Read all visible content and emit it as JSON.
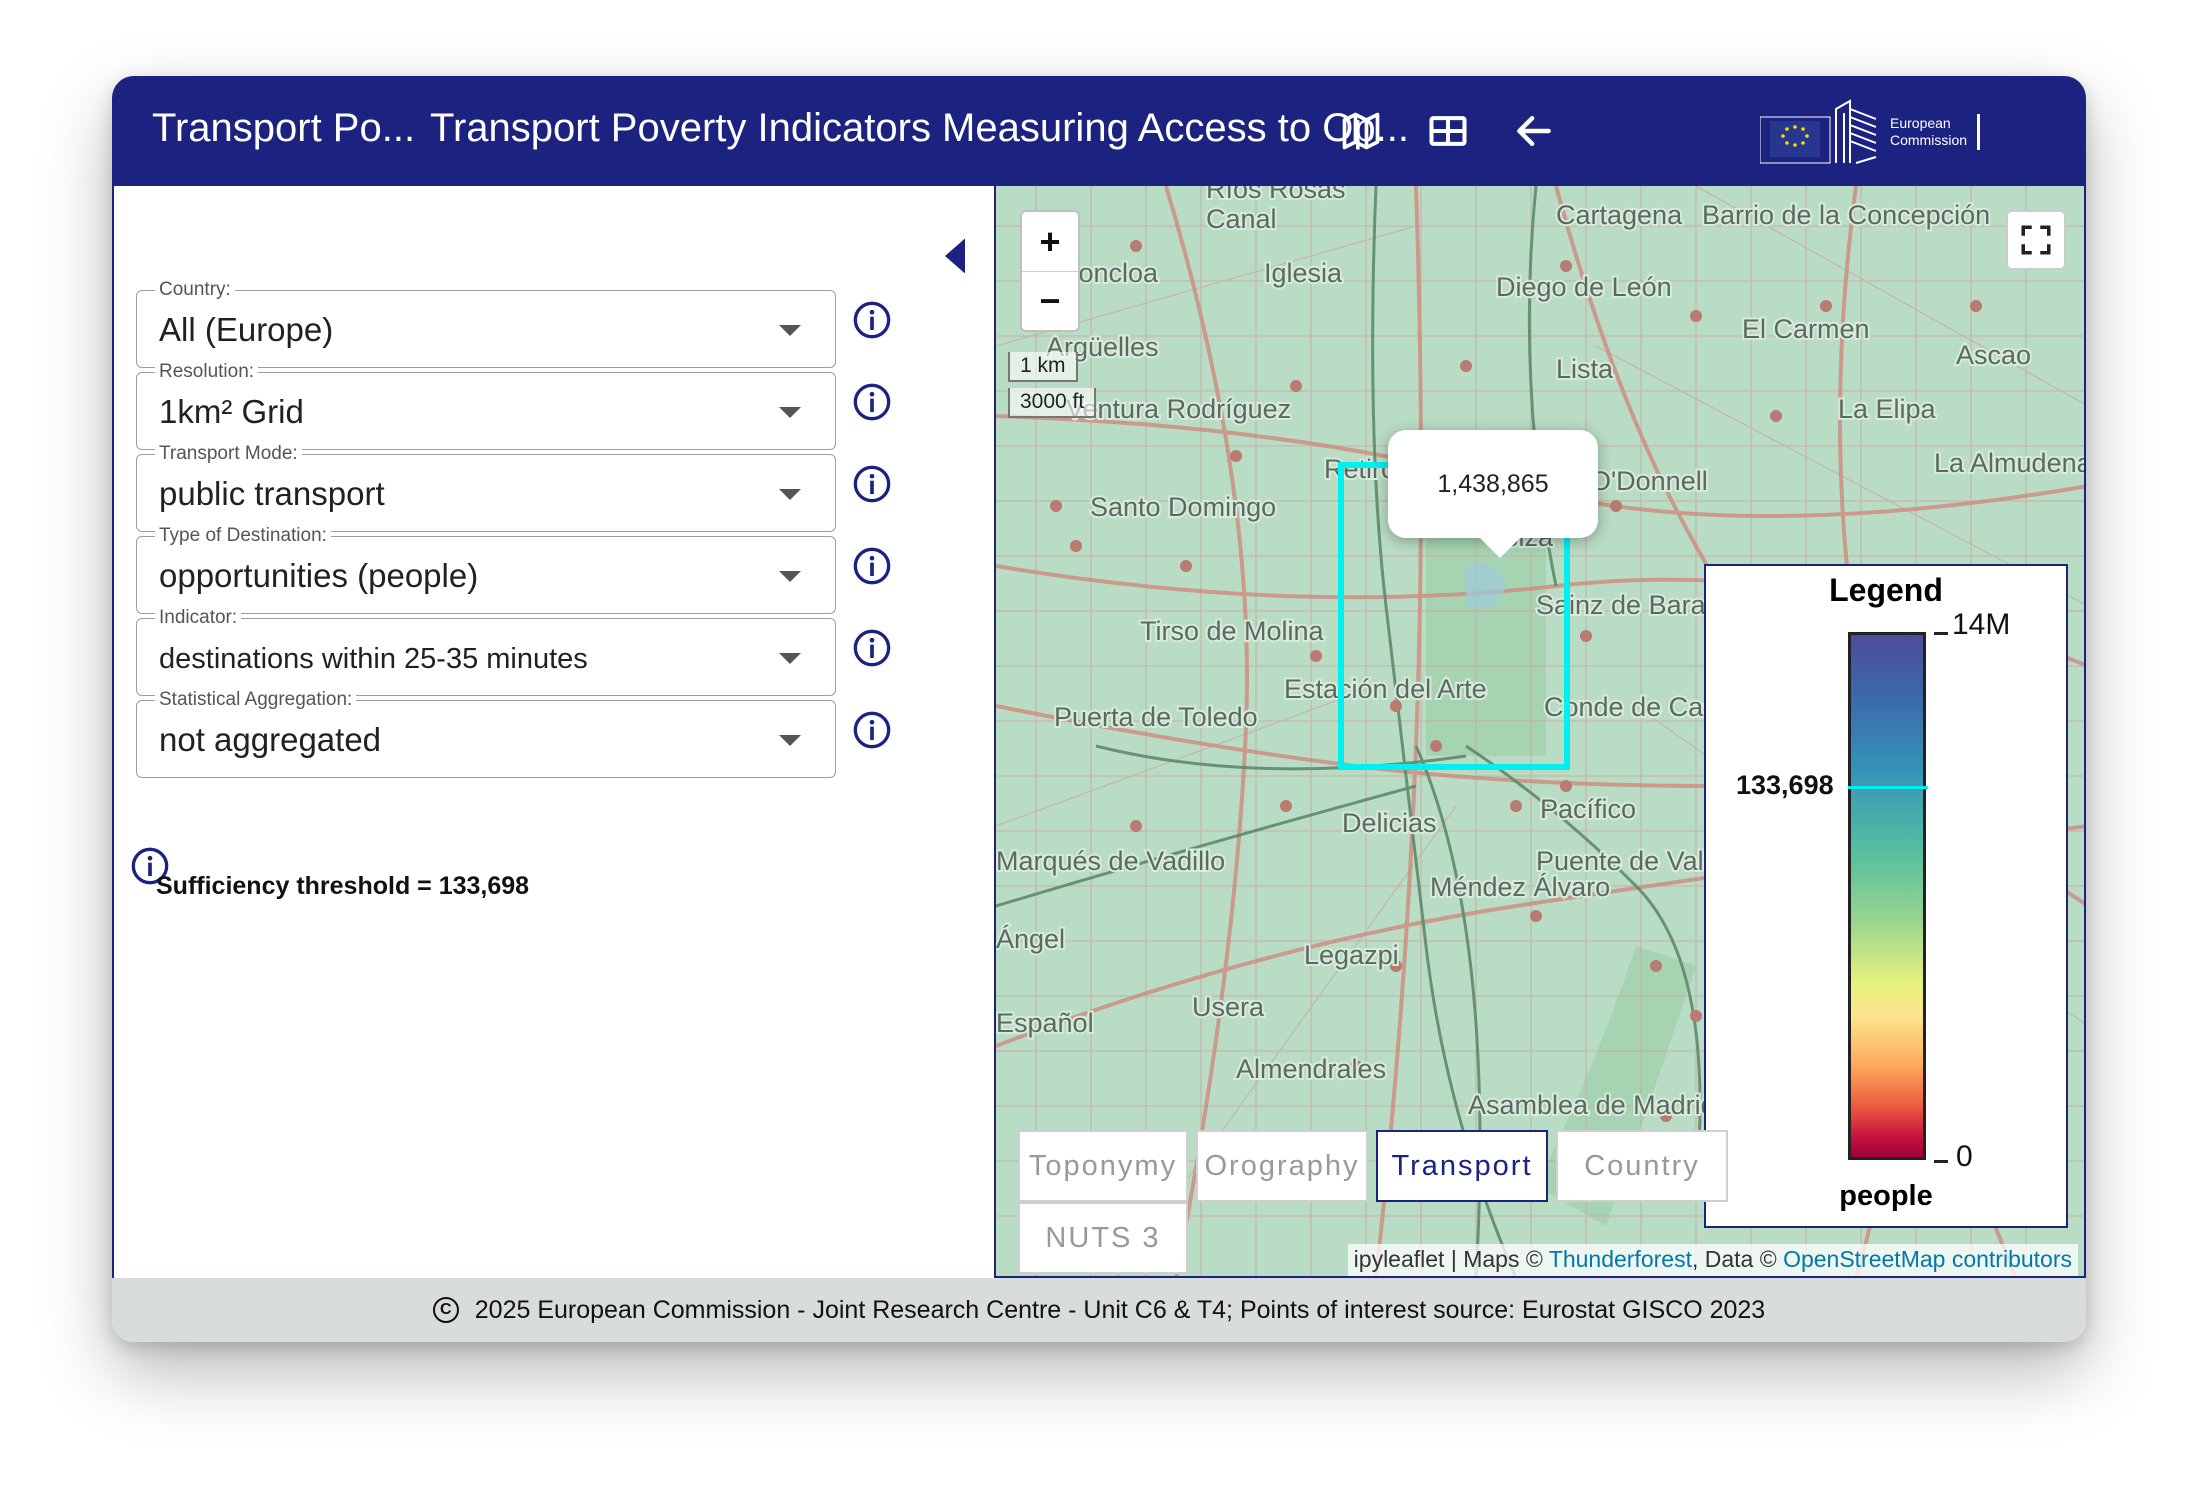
{
  "header": {
    "app_short": "Transport Po...",
    "title": "Transport Poverty Indicators Measuring Access to Op...",
    "map_view_icon": "map-icon",
    "table_view_icon": "table-icon",
    "back_icon": "arrow-left-icon",
    "logo_text_line1": "European",
    "logo_text_line2": "Commission"
  },
  "filters": [
    {
      "label": "Country:",
      "value": "All (Europe)"
    },
    {
      "label": "Resolution:",
      "value": "1km² Grid"
    },
    {
      "label": "Transport Mode:",
      "value": "public transport"
    },
    {
      "label": "Type of Destination:",
      "value": "opportunities (people)"
    },
    {
      "label": "Indicator:",
      "value": "destinations within 25-35 minutes"
    },
    {
      "label": "Statistical Aggregation:",
      "value": "not aggregated"
    }
  ],
  "threshold_text": "Sufficiency threshold = 133,698",
  "map": {
    "zoom_in": "+",
    "zoom_out": "−",
    "scale_metric": "1 km",
    "scale_imperial": "3000 ft",
    "popup_value": "1,438,865",
    "place_labels": [
      "Ríos Rosas",
      "Canal",
      "Iglesia",
      "Diego de León",
      "Cartagena",
      "Barrio de la Concepción",
      "El Carmen",
      "Ascao",
      "Argüelles",
      "Lista",
      "La Elipa",
      "Ventura Rodríguez",
      "La Almudena",
      "O'Donnell",
      "Santo Domingo",
      "Tirso de Molina",
      "Sainz de Baranda",
      "Estación del Arte",
      "Conde de Casal",
      "Puerta de Toledo",
      "Pacífico",
      "Delicias",
      "Marqués de Vadillo",
      "Puente de Vallecas",
      "Méndez Álvaro",
      "Legazpi",
      "Usera",
      "Almendrales",
      "Asamblea de Madrid",
      "Moncloa",
      "Retiro",
      "Ibiza",
      "Ángel",
      "Español"
    ],
    "layers": [
      "Toponymy",
      "Orography",
      "Transport",
      "Country",
      "NUTS 3"
    ],
    "active_layer": "Transport",
    "attribution_prefix": "ipyleaflet | Maps © ",
    "attribution_link1": "Thunderforest",
    "attribution_mid": ", Data © ",
    "attribution_link2": "OpenStreetMap contributors"
  },
  "legend": {
    "title": "Legend",
    "max": "14M",
    "min": "0",
    "marker": "133,698",
    "unit": "people"
  },
  "footer": {
    "text": "2025 European Commission - Joint Research Centre - Unit C6 & T4; Points of interest source: Eurostat GISCO 2023"
  },
  "colors": {
    "header_bg": "#1c2280",
    "highlight": "#00f0f0",
    "map_bg": "#b9dcc4",
    "footer_bg": "#d9dcdd"
  }
}
